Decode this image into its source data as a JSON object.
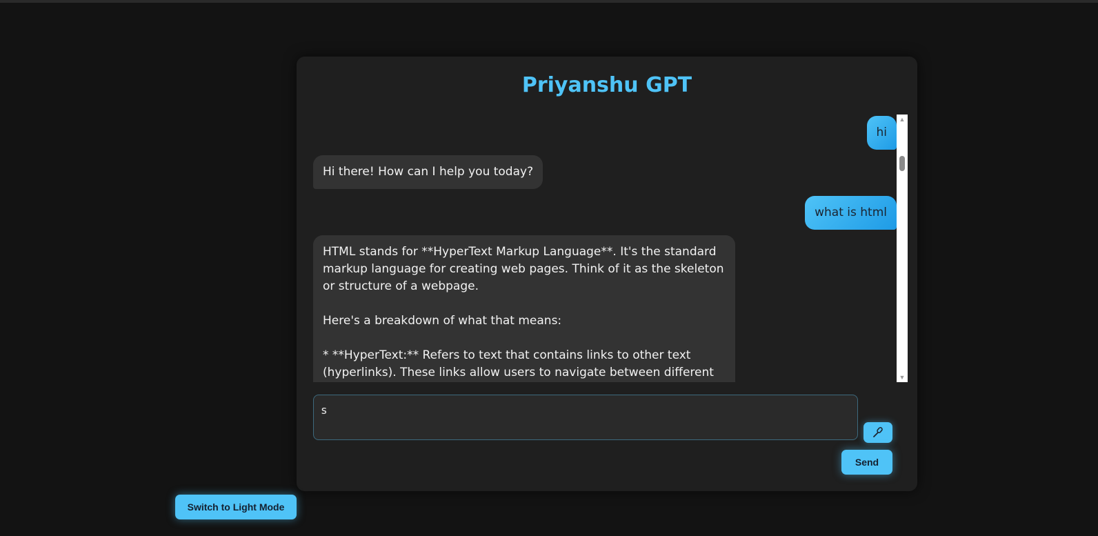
{
  "app": {
    "title": "Priyanshu GPT"
  },
  "messages": [
    {
      "role": "user",
      "text": "hi"
    },
    {
      "role": "bot",
      "text": "Hi there! How can I help you today?"
    },
    {
      "role": "user",
      "text": "what is html"
    },
    {
      "role": "bot",
      "text": "HTML stands for **HyperText Markup Language**. It's the standard markup language for creating web pages. Think of it as the skeleton or structure of a webpage.\n\nHere's a breakdown of what that means:\n\n*   **HyperText:** Refers to text that contains links to other text (hyperlinks).  These links allow users to navigate between different web"
    }
  ],
  "input": {
    "value": "s"
  },
  "buttons": {
    "send_label": "Send",
    "theme_toggle_label": "Switch to Light Mode",
    "mic_icon": "microphone-icon"
  },
  "colors": {
    "accent": "#4fc3f7",
    "background": "#131313",
    "card": "#1f1f1f",
    "bot_bubble": "#333333"
  }
}
